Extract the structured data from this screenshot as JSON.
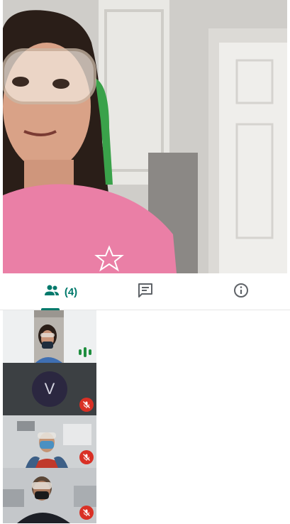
{
  "tabs": {
    "people_count": "(4)"
  },
  "participants": [
    {
      "avatar_initial": ""
    },
    {
      "avatar_initial": "V"
    },
    {
      "avatar_initial": ""
    },
    {
      "avatar_initial": ""
    }
  ],
  "colors": {
    "accent": "#00796b",
    "mute_badge": "#d93025",
    "speaking_indicator": "#1e8e3e"
  },
  "icons": {
    "people_tab": "people-icon",
    "chat_tab": "chat-icon",
    "info_tab": "info-icon",
    "muted": "mic-off-icon",
    "speaking": "audio-level-icon"
  }
}
